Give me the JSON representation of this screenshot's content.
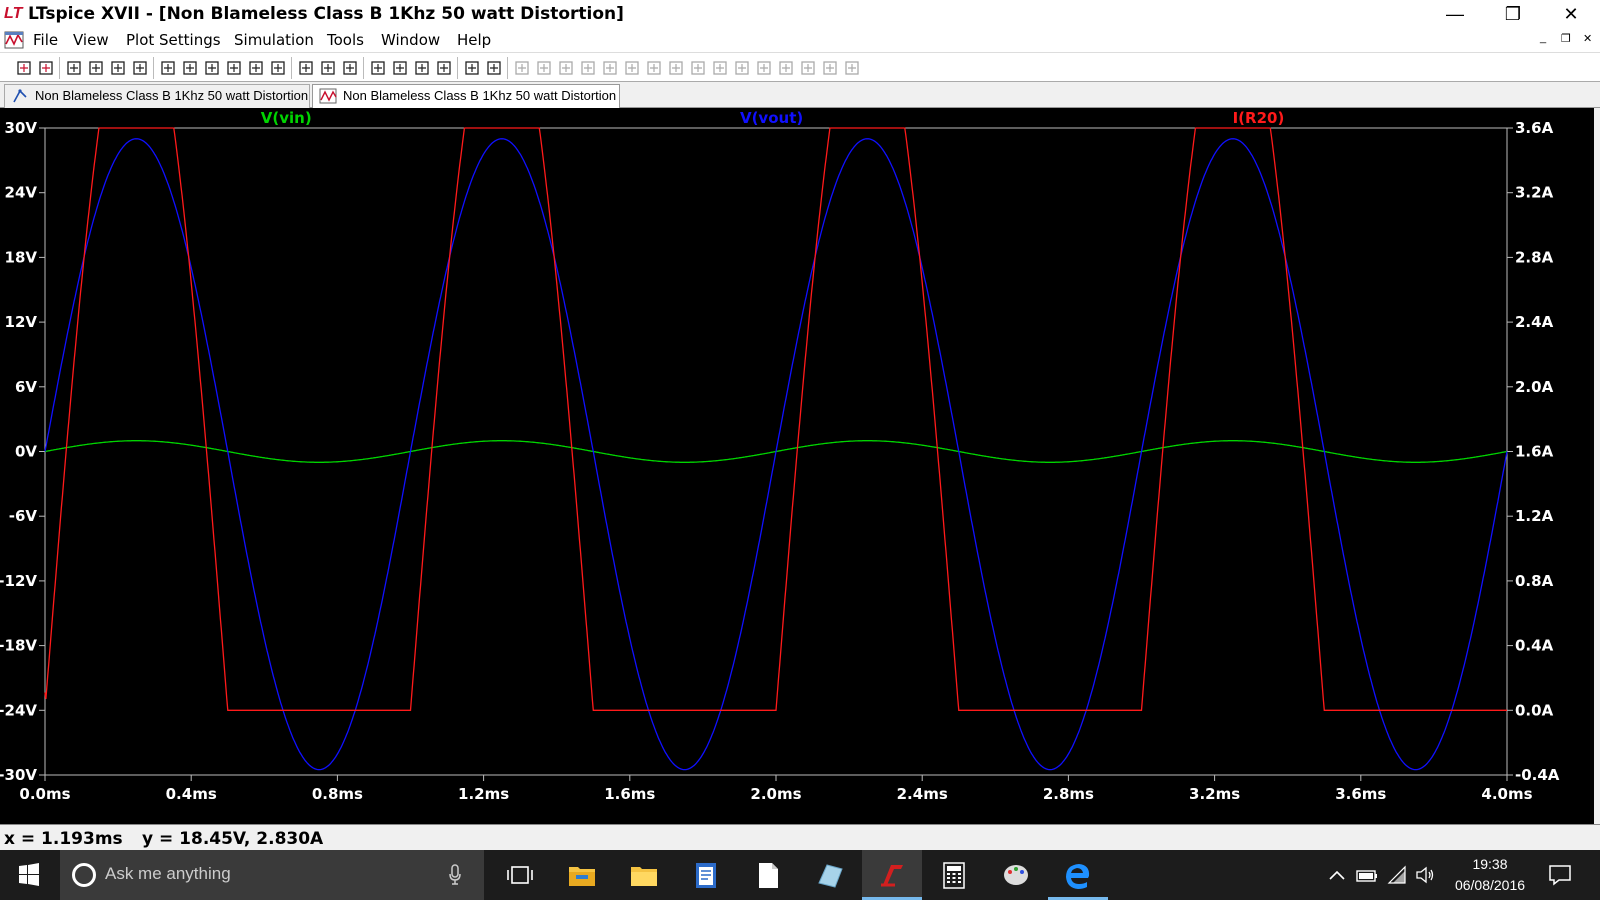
{
  "window": {
    "title": "LTspice XVII - [Non Blameless Class B 1Khz 50 watt Distortion]",
    "controls": {
      "minimize": "—",
      "maximize": "❐",
      "close": "✕"
    }
  },
  "menu": {
    "items": [
      "File",
      "View",
      "Plot Settings",
      "Simulation",
      "Tools",
      "Window",
      "Help"
    ],
    "mdi_controls": {
      "minimize": "_",
      "restore": "❐",
      "close": "✕"
    }
  },
  "toolbar": {
    "icons": [
      "new-schematic-icon",
      "open-icon",
      "save-icon",
      "control-panel-icon",
      "run-icon",
      "halt-icon",
      "zoom-in-icon",
      "zoom-out-icon",
      "zoom-full-icon",
      "zoom-cancel-icon",
      "autorange-icon",
      "fit-icon",
      "tile-horizontal-icon",
      "cascade-icon",
      "tile-vertical-icon",
      "cut-icon",
      "copy-icon",
      "paste-icon",
      "find-icon",
      "print-preview-icon",
      "print-icon",
      "wire-icon",
      "ground-icon",
      "label-icon",
      "resistor-icon",
      "capacitor-icon",
      "inductor-icon",
      "diode-icon",
      "component-icon",
      "move-icon",
      "drag-icon",
      "undo-icon",
      "redo-icon",
      "rotate-icon",
      "mirror-icon",
      "text-icon",
      "spice-directive-icon"
    ]
  },
  "tabs": [
    {
      "label": "Non Blameless Class B 1Khz 50 watt Distortion",
      "icon": "schematic-icon",
      "active": false
    },
    {
      "label": "Non Blameless Class B 1Khz 50 watt Distortion",
      "icon": "waveform-icon",
      "active": true
    }
  ],
  "status": {
    "cursor_x": "x = 1.193ms",
    "cursor_y": "y = 18.45V, 2.830A"
  },
  "taskbar": {
    "search_placeholder": "Ask me anything",
    "apps": [
      "task-view-icon",
      "file-explorer-icon",
      "folder-icon",
      "notepad-icon",
      "document-icon",
      "gadget-icon",
      "ltspice-icon",
      "calculator-icon",
      "paint-icon",
      "edge-icon"
    ],
    "tray": [
      "chevron-up-icon",
      "battery-icon",
      "wifi-icon",
      "volume-icon"
    ],
    "time": "19:38",
    "date": "06/08/2016"
  },
  "chart_data": {
    "type": "line",
    "title": "",
    "xlabel": "",
    "ylabel": "",
    "x_axis": {
      "range": [
        0,
        4.0
      ],
      "unit": "ms",
      "ticks": [
        "0.0ms",
        "0.4ms",
        "0.8ms",
        "1.2ms",
        "1.6ms",
        "2.0ms",
        "2.4ms",
        "2.8ms",
        "3.2ms",
        "3.6ms",
        "4.0ms"
      ]
    },
    "y_left": {
      "range": [
        -30,
        30
      ],
      "unit": "V",
      "ticks": [
        "30V",
        "24V",
        "18V",
        "12V",
        "6V",
        "0V",
        "-6V",
        "-12V",
        "-18V",
        "-24V",
        "-30V"
      ]
    },
    "y_right": {
      "range": [
        -0.4,
        3.6
      ],
      "unit": "A",
      "ticks": [
        "3.6A",
        "3.2A",
        "2.8A",
        "2.4A",
        "2.0A",
        "1.6A",
        "1.2A",
        "0.8A",
        "0.4A",
        "0.0A",
        "-0.4A"
      ]
    },
    "background": "#000000",
    "grid": false,
    "series": [
      {
        "name": "V(vin)",
        "color": "#00d400",
        "axis": "left",
        "label_position": "left",
        "shape": "sine",
        "frequency_khz": 1.0,
        "amplitude": 1.0,
        "offset": 0.0,
        "phase_deg": 0
      },
      {
        "name": "V(vout)",
        "color": "#1010ff",
        "axis": "left",
        "label_position": "center",
        "shape": "sine",
        "frequency_khz": 1.0,
        "amplitude": 29.0,
        "offset": 0.0,
        "phase_deg": 0,
        "negative_peak": -29.5
      },
      {
        "name": "I(R20)",
        "color": "#ff1a1a",
        "axis": "right",
        "label_position": "right",
        "shape": "half-wave-rectified",
        "frequency_khz": 1.0,
        "peak": 3.6,
        "floor": 0.0,
        "phase_deg": 0,
        "start_value": 0.11
      }
    ]
  }
}
